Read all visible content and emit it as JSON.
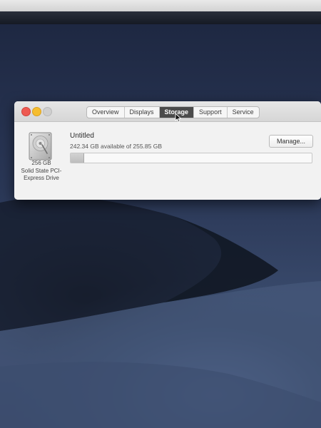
{
  "window": {
    "tabs": [
      {
        "label": "Overview",
        "active": false
      },
      {
        "label": "Displays",
        "active": false
      },
      {
        "label": "Storage",
        "active": true
      },
      {
        "label": "Support",
        "active": false
      },
      {
        "label": "Service",
        "active": false
      }
    ]
  },
  "storage": {
    "drive_icon": "hard-drive-icon",
    "drive_caption": [
      "256 GB",
      "Solid State PCI-",
      "Express Drive"
    ],
    "volume_name": "Untitled",
    "available_text": "242.34 GB available of 255.85 GB",
    "used_fraction": 0.053,
    "manage_label": "Manage..."
  },
  "colors": {
    "close": "#ee5a52",
    "minimize": "#f5bd2f",
    "zoom_disabled": "#cfcfcf",
    "active_tab": "#4b4b4b"
  }
}
